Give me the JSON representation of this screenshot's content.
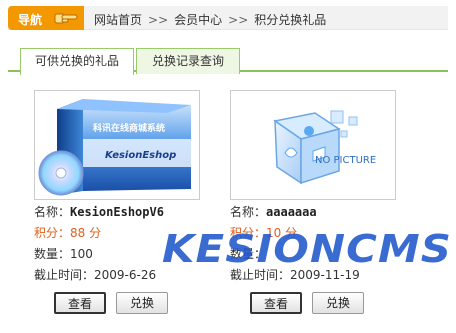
{
  "nav": {
    "tag_label": "导航",
    "crumbs": [
      "网站首页",
      "会员中心",
      "积分兑换礼品"
    ],
    "separator": ">>"
  },
  "tabs": [
    {
      "label": "可供兑换的礼品",
      "active": true
    },
    {
      "label": "兑换记录查询",
      "active": false
    }
  ],
  "gifts": [
    {
      "name_label": "名称：",
      "name": "KesionEshopV6",
      "points_label": "积分：",
      "points": "88 分",
      "quantity_label": "数量：",
      "quantity": "100",
      "deadline_label": "截止时间：",
      "deadline": "2009-6-26",
      "view_label": "查看",
      "redeem_label": "兑换",
      "box_title": "科讯在线商城系统",
      "box_logo": "KesionEshop"
    },
    {
      "name_label": "名称：",
      "name": "aaaaaaa",
      "points_label": "积分：",
      "points": "10 分",
      "quantity_label": "数量：",
      "deadline_label": "截止时间：",
      "deadline": "2009-11-19",
      "view_label": "查看",
      "redeem_label": "兑换",
      "placeholder_text": "NO PICTURE"
    }
  ],
  "watermark": "KESIONCMS",
  "colors": {
    "nav_tag": "#f39800",
    "tab_border": "#8cbf5d",
    "points_text": "#e0601e",
    "watermark": "#1f56c9"
  }
}
